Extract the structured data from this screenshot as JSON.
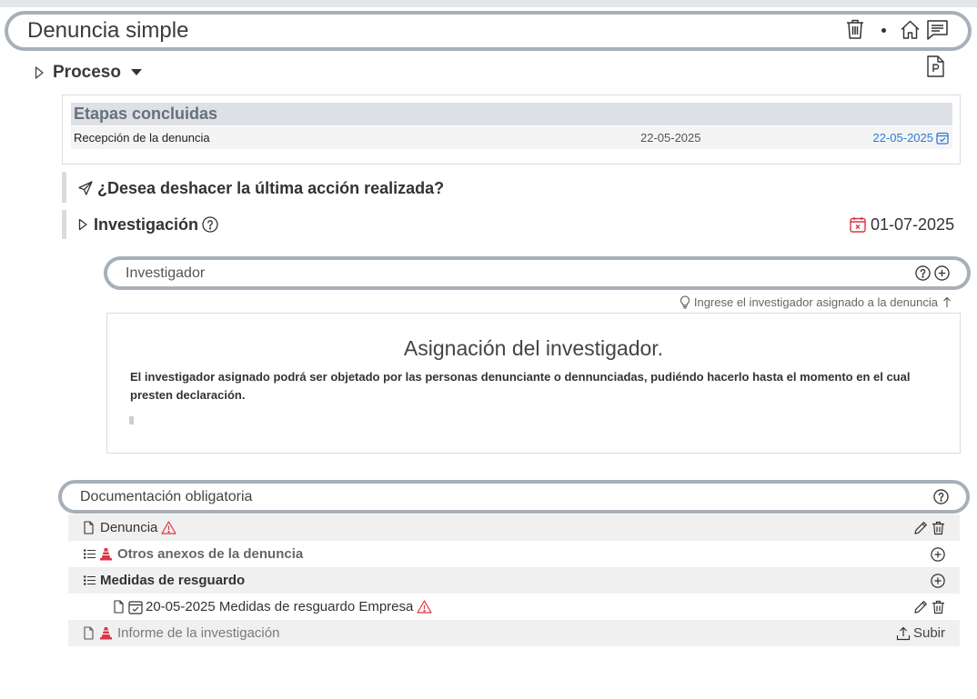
{
  "header": {
    "title": "Denuncia simple",
    "icons": {
      "delete": "trash-icon",
      "home": "home-icon",
      "comments": "chat-icon"
    }
  },
  "proceso": {
    "label": "Proceso",
    "toggle_icon": "expand-triangle-icon",
    "dropdown_icon": "caret-down-icon",
    "document_icon": "pdf-document-icon"
  },
  "etapas": {
    "title": "Etapas concluidas",
    "rows": [
      {
        "stage": "Recepción de la denuncia",
        "date": "22-05-2025",
        "date_link": "22-05-2025",
        "date_link_icon": "calendar-check-icon"
      }
    ]
  },
  "undo": {
    "icon": "send-icon",
    "question": "¿Desea deshacer la última acción realizada?"
  },
  "investigacion": {
    "label": "Investigación",
    "help_icon": "question-circle-icon",
    "due_icon": "calendar-x-icon",
    "due_date": "01-07-2025"
  },
  "investigador": {
    "placeholder": "Investigador",
    "value": "",
    "hint_icon": "lightbulb-icon",
    "hint": "Ingrese el investigador asignado a la denuncia",
    "hint_arrow_icon": "arrow-up-icon"
  },
  "asignacion": {
    "title": "Asignación del investigador.",
    "body": "El investigador asignado podrá ser objetado por las personas denunciante o dennunciadas, pudiéndo hacerlo hasta el momento en el cual presten declaración."
  },
  "documentacion": {
    "title": "Documentación obligatoria",
    "items": [
      {
        "label": "Denuncia",
        "icons": [
          "file-icon",
          "warning-icon"
        ],
        "actions": [
          "pencil-icon",
          "trash-icon"
        ]
      },
      {
        "label": "Otros anexos de la denuncia",
        "icons": [
          "list-icon",
          "traffic-cone-icon"
        ],
        "actions": [
          "plus-circle-icon"
        ]
      },
      {
        "label": "Medidas de resguardo",
        "icons": [
          "list-icon"
        ],
        "actions": [
          "plus-circle-icon"
        ]
      },
      {
        "label": "20-05-2025 Medidas de resguardo Empresa",
        "icons": [
          "file-icon",
          "calendar-check-icon",
          "warning-icon"
        ],
        "actions": [
          "pencil-icon",
          "trash-icon"
        ]
      },
      {
        "label": "Informe de la investigación",
        "icons": [
          "file-icon",
          "traffic-cone-icon"
        ],
        "actions": [
          "upload-icon"
        ],
        "action_label": "Subir"
      }
    ]
  },
  "colors": {
    "accent": "#2a7bd6",
    "danger": "#dc3545",
    "pill_border": "#a7b0b9",
    "row_alt": "#f0f0f0"
  }
}
